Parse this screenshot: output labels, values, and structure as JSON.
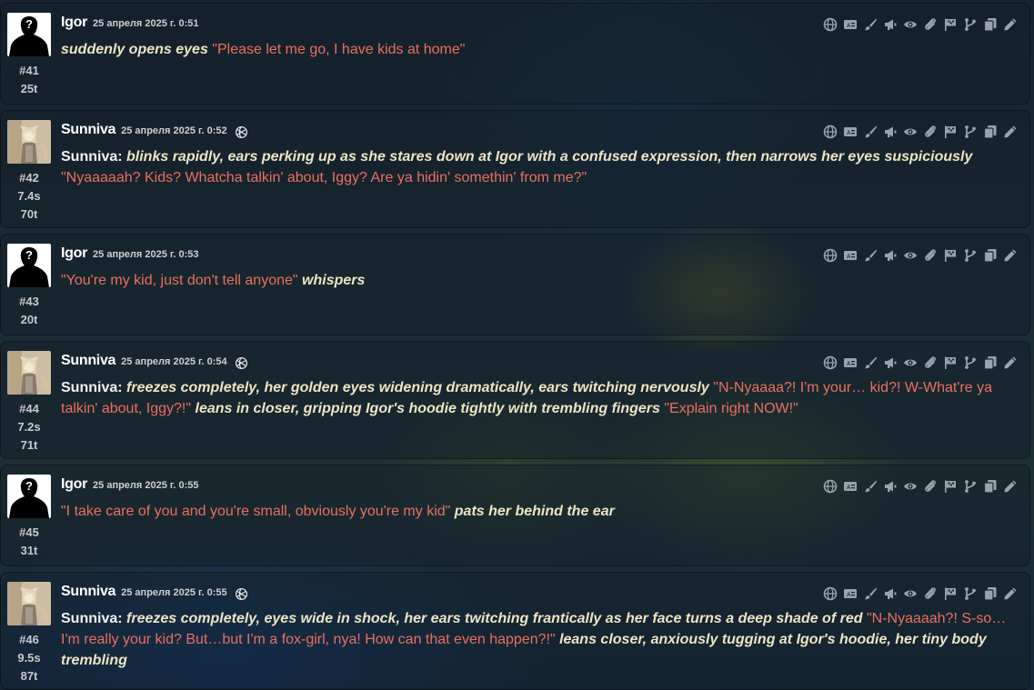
{
  "messages": [
    {
      "name": "Igor",
      "timestamp": "25 апреля 2025 г. 0:51",
      "ai_badge": false,
      "index": "#41",
      "timing": "",
      "tokens": "25t",
      "avatar": "igor",
      "parts": [
        {
          "type": "act",
          "text": "suddenly opens eyes"
        },
        {
          "type": "quote",
          "text": " \"Please let me go, I have kids at home\""
        }
      ]
    },
    {
      "name": "Sunniva",
      "timestamp": "25 апреля 2025 г. 0:52",
      "ai_badge": true,
      "index": "#42",
      "timing": "7.4s",
      "tokens": "70t",
      "avatar": "sunniva",
      "parts": [
        {
          "type": "speaker",
          "text": "Sunniva: "
        },
        {
          "type": "act",
          "text": "blinks rapidly, ears perking up as she stares down at Igor with a confused expression, then narrows her eyes suspiciously"
        },
        {
          "type": "quote",
          "text": " \"Nyaaaaah? Kids? Whatcha talkin' about, Iggy? Are ya hidin' somethin' from me?\""
        }
      ]
    },
    {
      "name": "Igor",
      "timestamp": "25 апреля 2025 г. 0:53",
      "ai_badge": false,
      "index": "#43",
      "timing": "",
      "tokens": "20t",
      "avatar": "igor",
      "parts": [
        {
          "type": "quote",
          "text": "\"You're my kid, just don't tell anyone\" "
        },
        {
          "type": "act",
          "text": "whispers"
        }
      ]
    },
    {
      "name": "Sunniva",
      "timestamp": "25 апреля 2025 г. 0:54",
      "ai_badge": true,
      "index": "#44",
      "timing": "7.2s",
      "tokens": "71t",
      "avatar": "sunniva",
      "parts": [
        {
          "type": "speaker",
          "text": "Sunniva: "
        },
        {
          "type": "act",
          "text": "freezes completely, her golden eyes widening dramatically, ears twitching nervously"
        },
        {
          "type": "quote",
          "text": " \"N-Nyaaaa?! I'm your… kid?! W-What're ya talkin' about, Iggy?!\" "
        },
        {
          "type": "act",
          "text": "leans in closer, gripping Igor's hoodie tightly with trembling fingers"
        },
        {
          "type": "quote",
          "text": " \"Explain right NOW!\""
        }
      ]
    },
    {
      "name": "Igor",
      "timestamp": "25 апреля 2025 г. 0:55",
      "ai_badge": false,
      "index": "#45",
      "timing": "",
      "tokens": "31t",
      "avatar": "igor",
      "parts": [
        {
          "type": "quote",
          "text": "\"I take care of you and you're small, obviously you're my kid\" "
        },
        {
          "type": "act",
          "text": "pats her behind the ear"
        }
      ]
    },
    {
      "name": "Sunniva",
      "timestamp": "25 апреля 2025 г. 0:55",
      "ai_badge": true,
      "index": "#46",
      "timing": "9.5s",
      "tokens": "87t",
      "avatar": "sunniva",
      "parts": [
        {
          "type": "speaker",
          "text": "Sunniva: "
        },
        {
          "type": "act",
          "text": "freezes completely, eyes wide in shock, her ears twitching frantically as her face turns a deep shade of red"
        },
        {
          "type": "quote",
          "text": " \"N-Nyaaaah?! S-so…I'm really your kid? But…but I'm a fox-girl, nya! How can that even happen?!\" "
        },
        {
          "type": "act",
          "text": "leans closer, anxiously tugging at Igor's hoodie, her tiny body trembling"
        }
      ]
    }
  ],
  "toolbar_icons": [
    "translate-icon",
    "caption-icon",
    "brush-icon",
    "megaphone-icon",
    "eye-icon",
    "paperclip-icon",
    "flag-icon",
    "branch-icon",
    "copy-icon",
    "edit-icon"
  ],
  "colors": {
    "quote": "#e9705f",
    "action": "#ece4c4",
    "icon": "#9aa3ab"
  }
}
